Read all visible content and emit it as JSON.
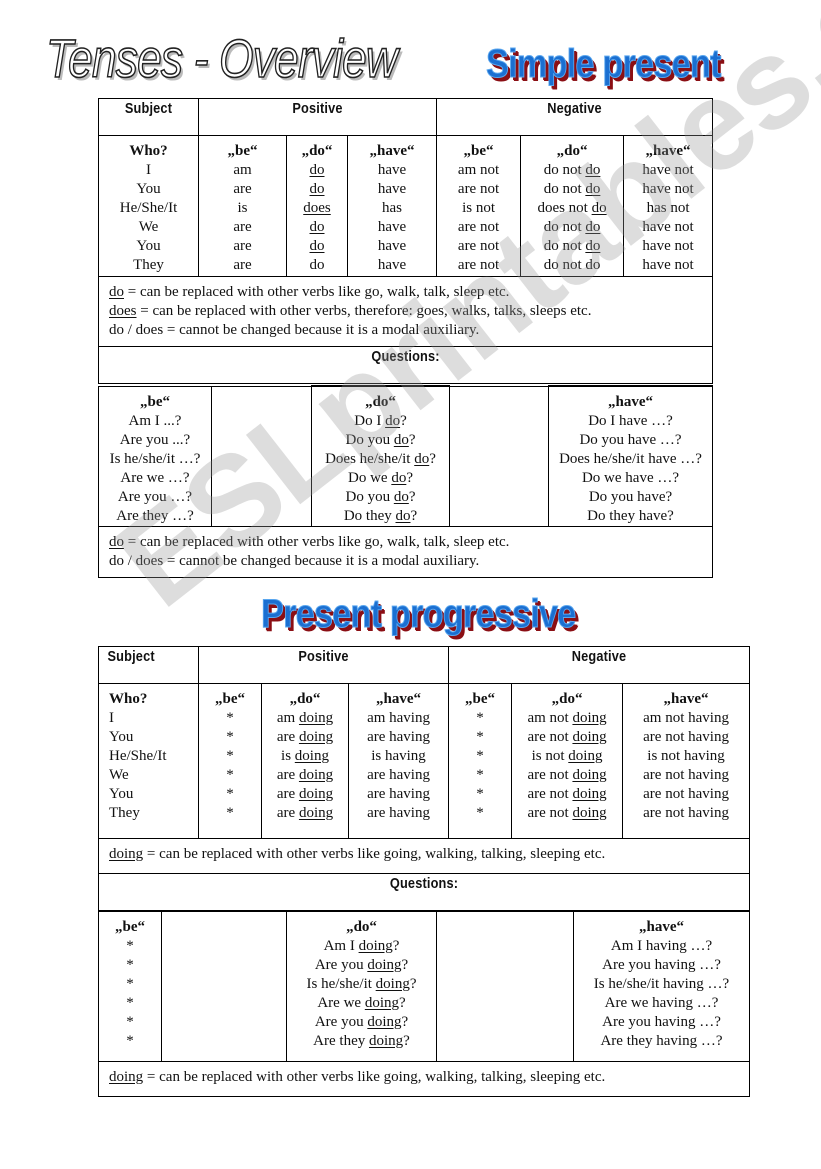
{
  "page": {
    "title": "Tenses - Overview",
    "watermark": "ESLprintables.com",
    "colors": {
      "wordart_fill": "#1b6fd1",
      "wordart_shadow": "#8b0f14",
      "wordart_outline": "#5aa7ef"
    }
  },
  "simple_present": {
    "heading": "Simple present",
    "headers": {
      "subject": "Subject",
      "positive": "Positive",
      "negative": "Negative"
    },
    "columns": {
      "who": "Who?",
      "be": "„be“",
      "do": "„do“",
      "have": "„have“"
    },
    "subjects": [
      "I",
      "You",
      "He/She/It",
      "We",
      "You",
      "They"
    ],
    "positive": {
      "be": [
        "am",
        "are",
        "is",
        "are",
        "are",
        "are"
      ],
      "do": [
        "do",
        "do",
        "does",
        "do",
        "do",
        "do"
      ],
      "do_underlined": [
        true,
        true,
        true,
        true,
        true,
        false
      ],
      "have": [
        "have",
        "have",
        "has",
        "have",
        "have",
        "have"
      ]
    },
    "negative": {
      "be": [
        "am not",
        "are not",
        "is not",
        "are not",
        "are not",
        "are not"
      ],
      "do_prefix": [
        "do not",
        "do not",
        "does not",
        "do not",
        "do not",
        "do not"
      ],
      "do_verb": [
        "do",
        "do",
        "do",
        "do",
        "do",
        "do"
      ],
      "do_underlined": [
        true,
        true,
        true,
        true,
        true,
        false
      ],
      "have": [
        "have not",
        "have not",
        "has not",
        "have not",
        "have not",
        "have not"
      ]
    },
    "notes": [
      {
        "key": "do",
        "underlined": true,
        "text": " = can be replaced with other verbs like go, walk, talk, sleep etc."
      },
      {
        "key": "does",
        "underlined": true,
        "text": " = can be replaced with other verbs, therefore: goes, walks, talks, sleeps etc."
      },
      {
        "key": "do / does",
        "underlined": false,
        "text": " = cannot be changed because it is a modal auxiliary."
      }
    ],
    "questions_label": "Questions:",
    "questions": {
      "be": [
        "Am I ...?",
        "Are you ...?",
        "Is he/she/it …?",
        "Are we …?",
        "Are you …?",
        "Are they …?"
      ],
      "do": [
        {
          "pre": "Do I ",
          "u": "do",
          "post": "?"
        },
        {
          "pre": "Do you ",
          "u": "do",
          "post": "?"
        },
        {
          "pre": "Does he/she/it ",
          "u": "do",
          "post": "?"
        },
        {
          "pre": "Do we ",
          "u": "do",
          "post": "?"
        },
        {
          "pre": "Do you ",
          "u": "do",
          "post": "?"
        },
        {
          "pre": "Do they ",
          "u": "do",
          "post": "?"
        }
      ],
      "have": [
        "Do I have …?",
        "Do you have …?",
        "Does he/she/it have …?",
        "Do we have …?",
        "Do you have?",
        "Do they have?"
      ]
    },
    "question_notes": [
      {
        "key": "do",
        "underlined": true,
        "text": " = can be replaced with other verbs like go, walk, talk, sleep etc."
      },
      {
        "key": "do / does",
        "underlined": false,
        "text": " = cannot be changed because it is a modal auxiliary."
      }
    ]
  },
  "present_progressive": {
    "heading": "Present progressive",
    "headers": {
      "subject": "Subject",
      "positive": "Positive",
      "negative": "Negative"
    },
    "columns": {
      "who": "Who?",
      "be": "„be“",
      "do": "„do“",
      "have": "„have“"
    },
    "subjects": [
      "I",
      "You",
      "He/She/It",
      "We",
      "You",
      "They"
    ],
    "positive": {
      "be": [
        "*",
        "*",
        "*",
        "*",
        "*",
        "*"
      ],
      "do_prefix": [
        "am",
        "are",
        "is",
        "are",
        "are",
        "are"
      ],
      "do_verb": [
        "doing",
        "doing",
        "doing",
        "doing",
        "doing",
        "doing"
      ],
      "have": [
        "am having",
        "are having",
        "is having",
        "are having",
        "are having",
        "are having"
      ]
    },
    "negative": {
      "be": [
        "*",
        "*",
        "*",
        "*",
        "*",
        "*"
      ],
      "do_prefix": [
        "am not",
        "are not",
        "is not",
        "are not",
        "are not",
        "are not"
      ],
      "do_verb": [
        "doing",
        "doing",
        "doing",
        "doing",
        "doing",
        "doing"
      ],
      "have": [
        "am not having",
        "are not having",
        "is not having",
        "are not having",
        "are not having",
        "are not having"
      ]
    },
    "notes": [
      {
        "key": "doing",
        "underlined": true,
        "text": " = can be replaced with other verbs like going, walking, talking, sleeping etc."
      }
    ],
    "questions_label": "Questions:",
    "questions": {
      "be": [
        "*",
        "*",
        "*",
        "*",
        "*",
        "*"
      ],
      "do": [
        {
          "pre": "Am I ",
          "u": "doing",
          "post": "?"
        },
        {
          "pre": "Are you ",
          "u": "doing",
          "post": "?"
        },
        {
          "pre": "Is he/she/it ",
          "u": "doing",
          "post": "?"
        },
        {
          "pre": "Are we ",
          "u": "doing",
          "post": "?"
        },
        {
          "pre": "Are you ",
          "u": "doing",
          "post": "?"
        },
        {
          "pre": "Are they ",
          "u": "doing",
          "post": "?"
        }
      ],
      "have": [
        "Am I having …?",
        "Are you having …?",
        "Is he/she/it having …?",
        "Are we having …?",
        "Are you having …?",
        "Are they having …?"
      ]
    },
    "question_notes": [
      {
        "key": "doing",
        "underlined": true,
        "text": " = can be replaced with other verbs like going, walking, talking, sleeping etc."
      }
    ]
  }
}
